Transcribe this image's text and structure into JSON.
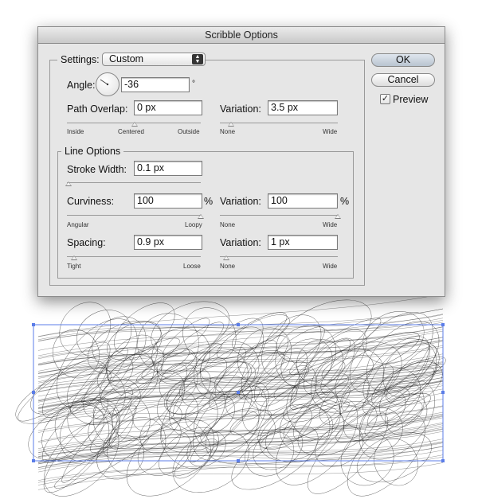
{
  "dialog": {
    "title": "Scribble Options",
    "settings": {
      "label": "Settings:",
      "value": "Custom"
    },
    "angle": {
      "label": "Angle:",
      "value": "-36",
      "unit": "°"
    },
    "path_overlap": {
      "label": "Path Overlap:",
      "value": "0 px",
      "ticks": [
        "Inside",
        "Centered",
        "Outside"
      ],
      "variation": {
        "label": "Variation:",
        "value": "3.5 px",
        "ticks": [
          "None",
          "Wide"
        ]
      }
    },
    "line_options": {
      "title": "Line Options",
      "stroke_width": {
        "label": "Stroke Width:",
        "value": "0.1 px"
      },
      "curviness": {
        "label": "Curviness:",
        "value": "100",
        "unit": "%",
        "ticks": [
          "Angular",
          "Loopy"
        ],
        "variation": {
          "label": "Variation:",
          "value": "100",
          "unit": "%",
          "ticks": [
            "None",
            "Wide"
          ]
        }
      },
      "spacing": {
        "label": "Spacing:",
        "value": "0.9 px",
        "ticks": [
          "Tight",
          "Loose"
        ],
        "variation": {
          "label": "Variation:",
          "value": "1 px",
          "ticks": [
            "None",
            "Wide"
          ]
        }
      }
    },
    "buttons": {
      "ok": "OK",
      "cancel": "Cancel"
    },
    "preview": {
      "label": "Preview",
      "checked": true
    }
  },
  "colors": {
    "selection": "#5b7de8",
    "dialog_bg": "#e6e6e6",
    "stroke": "#1a1a1a"
  }
}
